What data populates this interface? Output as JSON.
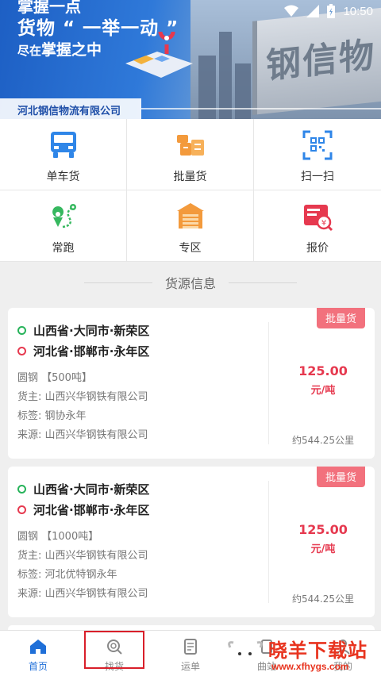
{
  "status_bar": {
    "time": "10:50"
  },
  "banner": {
    "line1": "掌握一点",
    "line2": "货物 “ 一举一动 ”",
    "line3_prefix": "尽在",
    "line3_main": "掌握之中",
    "company": "河北钢信物流有限公司",
    "truck_text": "钢信物"
  },
  "grid": [
    {
      "label": "单车货",
      "icon": "truck-icon"
    },
    {
      "label": "批量货",
      "icon": "boxes-icon"
    },
    {
      "label": "扫一扫",
      "icon": "scan-icon"
    },
    {
      "label": "常跑",
      "icon": "route-pin-icon"
    },
    {
      "label": "专区",
      "icon": "warehouse-icon"
    },
    {
      "label": "报价",
      "icon": "quote-icon"
    }
  ],
  "section_title": "货源信息",
  "cards": [
    {
      "from": "山西省·大同市·新荣区",
      "to": "河北省·邯郸市·永年区",
      "cargo": "圆钢 【500吨】",
      "owner": "货主: 山西兴华钢铁有限公司",
      "tag": "标签: 钢协永年",
      "source": "来源: 山西兴华钢铁有限公司",
      "badge": "批量货",
      "price": "125.00",
      "unit": "元/吨",
      "distance": "约544.25公里"
    },
    {
      "from": "山西省·大同市·新荣区",
      "to": "河北省·邯郸市·永年区",
      "cargo": "圆钢 【1000吨】",
      "owner": "货主: 山西兴华钢铁有限公司",
      "tag": "标签: 河北优特钢永年",
      "source": "来源: 山西兴华钢铁有限公司",
      "badge": "批量货",
      "price": "125.00",
      "unit": "元/吨",
      "distance": "约544.25公里"
    }
  ],
  "nav": {
    "items": [
      {
        "label": "首页",
        "active": true
      },
      {
        "label": "找货",
        "active": false
      },
      {
        "label": "运单",
        "active": false
      },
      {
        "label": "曲站",
        "active": false
      },
      {
        "label": "我的",
        "active": false
      }
    ]
  },
  "watermark": {
    "title": "晓羊下载站",
    "url": "www.xfhygs.com"
  },
  "colors": {
    "primary": "#1f6fd8",
    "price": "#e6394f",
    "badge": "#f2717d",
    "origin_dot": "#27b35a"
  }
}
